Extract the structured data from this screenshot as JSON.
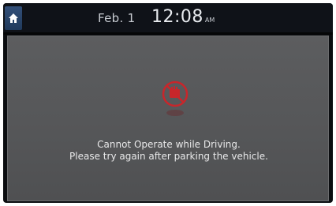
{
  "status_bar": {
    "date": "Feb.  1",
    "time": "12:08",
    "ampm": "AM"
  },
  "message": {
    "line1": "Cannot Operate while Driving.",
    "line2": "Please try again after parking the vehicle."
  },
  "icons": {
    "home": "home-icon",
    "warning": "no-operation-while-driving-icon"
  },
  "colors": {
    "home_button": "#2b4a74",
    "warning_red": "#c8262b",
    "panel": "#58595b"
  }
}
